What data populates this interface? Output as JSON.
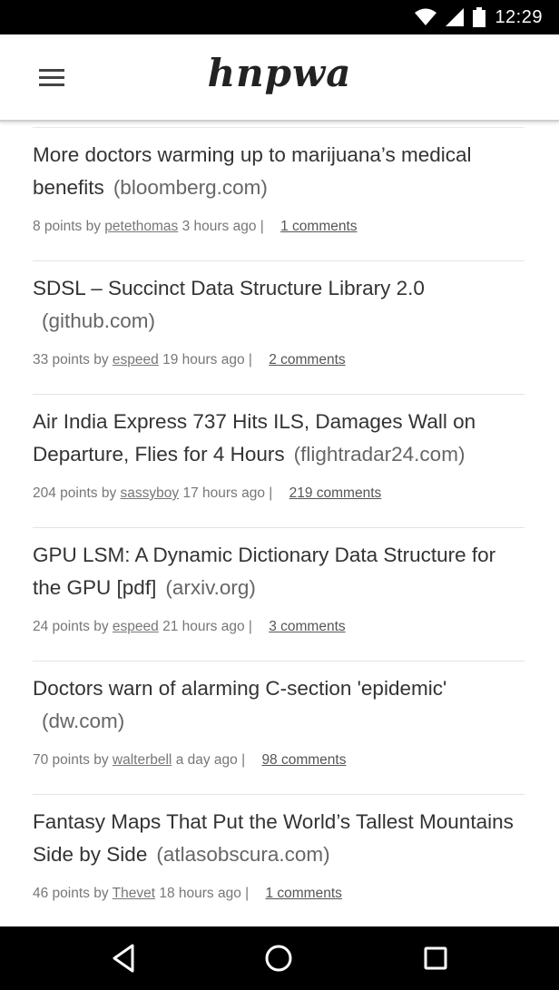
{
  "status_bar": {
    "time": "12:29",
    "icons": [
      "wifi-icon",
      "signal-icon",
      "battery-icon"
    ]
  },
  "header": {
    "logo_text": "hnpwa",
    "menu_icon": "hamburger-menu-icon"
  },
  "items": [
    {
      "title": "More doctors warming up to marijuana’s medical benefits",
      "domain": "(bloomberg.com)",
      "points": "8 points by",
      "user": "petethomas",
      "time": "3 hours ago |",
      "comments": "1 comments"
    },
    {
      "title": "SDSL – Succinct Data Structure Library 2.0",
      "domain": "(github.com)",
      "points": "33 points by",
      "user": "espeed",
      "time": "19 hours ago |",
      "comments": "2 comments"
    },
    {
      "title": "Air India Express 737 Hits ILS, Damages Wall on Departure, Flies for 4 Hours",
      "domain": "(flightradar24.com)",
      "points": "204 points by",
      "user": "sassyboy",
      "time": "17 hours ago |",
      "comments": "219 comments"
    },
    {
      "title": "GPU LSM: A Dynamic Dictionary Data Structure for the GPU [pdf]",
      "domain": "(arxiv.org)",
      "points": "24 points by",
      "user": "espeed",
      "time": "21 hours ago |",
      "comments": "3 comments"
    },
    {
      "title": "Doctors warn of alarming C-section 'epidemic'",
      "domain": "(dw.com)",
      "points": "70 points by",
      "user": "walterbell",
      "time": "a day ago |",
      "comments": "98 comments"
    },
    {
      "title": "Fantasy Maps That Put the World’s Tallest Mountains Side by Side",
      "domain": "(atlasobscura.com)",
      "points": "46 points by",
      "user": "Thevet",
      "time": "18 hours ago |",
      "comments": "1 comments"
    }
  ],
  "nav_bar": {
    "icons": [
      "back-icon",
      "home-icon",
      "recents-icon"
    ]
  },
  "colors": {
    "status_bar": "#000000",
    "nav_bar": "#000000",
    "text": "#333333",
    "meta": "#777777"
  }
}
